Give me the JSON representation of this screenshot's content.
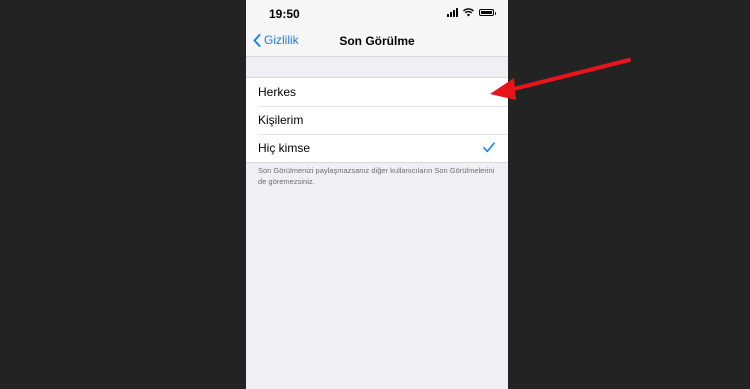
{
  "status_bar": {
    "time": "19:50"
  },
  "nav": {
    "back_label": "Gizlilik",
    "title": "Son Görülme"
  },
  "options": [
    {
      "label": "Herkes",
      "selected": false
    },
    {
      "label": "Kişilerim",
      "selected": false
    },
    {
      "label": "Hiç kimse",
      "selected": true
    }
  ],
  "footer_note": "Son Görülmenizi paylaşmazsanız diğer kullanıcıların Son Görülmelerini de göremezsiniz.",
  "colors": {
    "accent": "#1a7ff5",
    "arrow": "#e8141b",
    "backdrop": "#232323"
  }
}
